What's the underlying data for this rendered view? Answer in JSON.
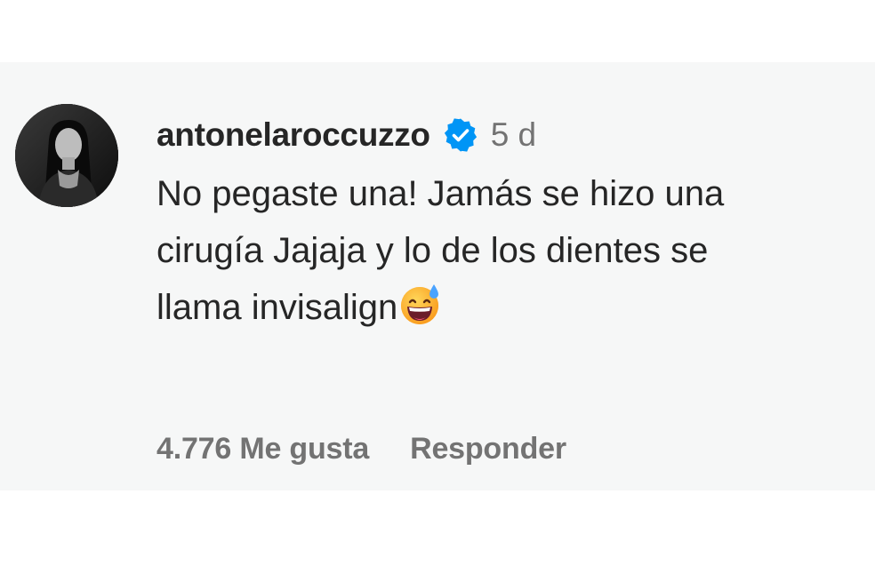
{
  "comment": {
    "username": "antonelaroccuzzo",
    "verified_icon": "verified-badge-icon",
    "timestamp": "5 d",
    "text_line1": "No pegaste una! Jamás se hizo una",
    "text_line2": "cirugía Jajaja y lo de los dientes se",
    "text_line3": "llama invisalign",
    "emoji_icon": "grinning-sweat-emoji-icon",
    "likes_label": "4.776 Me gusta",
    "reply_label": "Responder"
  },
  "colors": {
    "card_background": "#f6f7f7",
    "text_primary": "#262626",
    "text_secondary": "#737373",
    "verified_blue": "#0095f6"
  }
}
